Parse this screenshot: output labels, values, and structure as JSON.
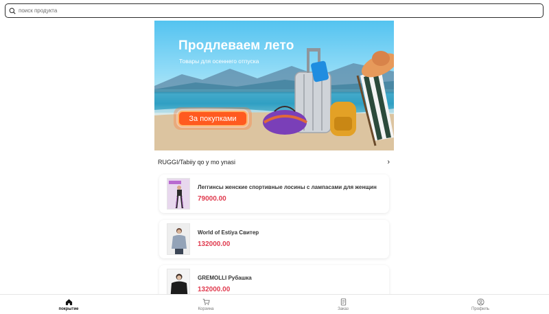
{
  "search": {
    "placeholder": "поиск продукта",
    "icon": "search-icon"
  },
  "banner": {
    "title": "Продлеваем лето",
    "subtitle": "Товары для осеннего отпуска",
    "button_label": "За покупками"
  },
  "brand_section": {
    "title": "RUGGI/Tabiiy qo y mo ynasi",
    "chevron": "›"
  },
  "products": [
    {
      "name": "Леггинсы женские спортивные лосины с лампасами для женщин",
      "price": "79000.00"
    },
    {
      "name": "World of Estiya Свитер",
      "price": "132000.00"
    },
    {
      "name": "GREMOLLI Рубашка",
      "price": "132000.00"
    }
  ],
  "bottom_nav": [
    {
      "label": "покрытие",
      "icon": "home-icon",
      "active": true
    },
    {
      "label": "Корзина",
      "icon": "cart-icon",
      "active": false
    },
    {
      "label": "Заказ",
      "icon": "order-icon",
      "active": false
    },
    {
      "label": "Профиль",
      "icon": "profile-icon",
      "active": false
    }
  ],
  "colors": {
    "price": "#e03b4f",
    "button": "#ff5a1f",
    "border": "#2a2a2a"
  }
}
